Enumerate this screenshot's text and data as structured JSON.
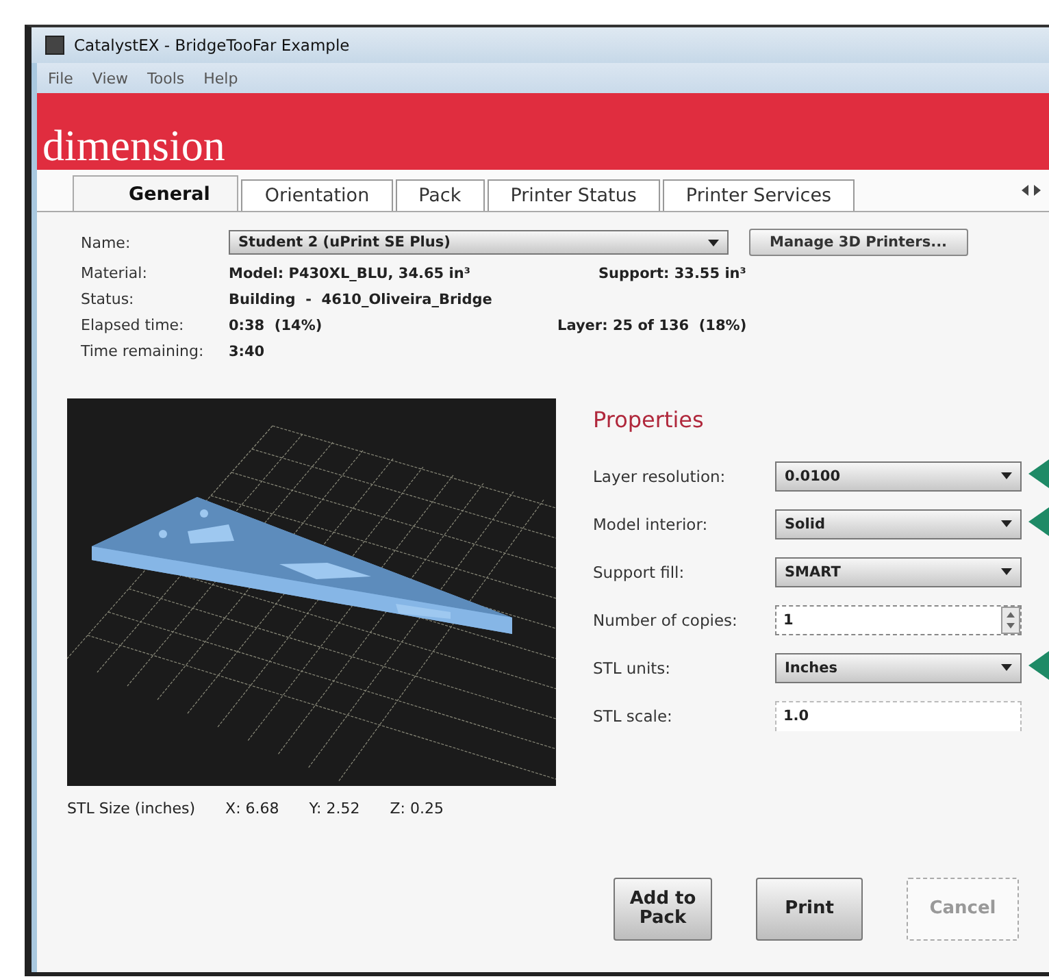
{
  "window": {
    "title": "CatalystEX - BridgeTooFar Example"
  },
  "menu": [
    "File",
    "View",
    "Tools",
    "Help"
  ],
  "logo": "dimension",
  "tabs": [
    {
      "label": "General",
      "selected": true
    },
    {
      "label": "Orientation",
      "selected": false
    },
    {
      "label": "Pack",
      "selected": false
    },
    {
      "label": "Printer Status",
      "selected": false
    },
    {
      "label": "Printer Services",
      "selected": false
    }
  ],
  "info": {
    "name": {
      "label": "Name:",
      "value": "Student 2  (uPrint SE Plus)"
    },
    "manage_button": "Manage 3D Printers...",
    "material": {
      "label": "Material:",
      "value": "Model: P430XL_BLU, 34.65 in³",
      "extra": "Support: 33.55 in³"
    },
    "status": {
      "label": "Status:",
      "value": "Building  -  4610_Oliveira_Bridge"
    },
    "elapsed": {
      "label": "Elapsed time:",
      "value": "0:38  (14%)",
      "extra": "Layer: 25 of 136  (18%)"
    },
    "remaining": {
      "label": "Time remaining:",
      "value": "3:40"
    }
  },
  "stl_size": {
    "label": "STL Size (inches)",
    "x": "X:  6.68",
    "y": "Y:  2.52",
    "z": "Z:  0.25"
  },
  "properties": {
    "title": "Properties",
    "fields": [
      {
        "label": "Layer resolution:",
        "kind": "dropdown",
        "value": "0.0100",
        "callout": true
      },
      {
        "label": "Model interior:",
        "kind": "dropdown",
        "value": "Solid",
        "callout": true
      },
      {
        "label": "Support fill:",
        "kind": "dropdown",
        "value": "SMART",
        "callout": false
      },
      {
        "label": "Number of copies:",
        "kind": "spin",
        "value": "1",
        "callout": false
      },
      {
        "label": "STL units:",
        "kind": "dropdown",
        "value": "Inches",
        "callout": true
      },
      {
        "label": "STL scale:",
        "kind": "text",
        "value": "1.0",
        "callout": false
      }
    ]
  },
  "buttons": [
    {
      "label": "Add to Pack",
      "disabled": false
    },
    {
      "label": "Print",
      "disabled": false
    },
    {
      "label": "Cancel",
      "disabled": true
    }
  ]
}
